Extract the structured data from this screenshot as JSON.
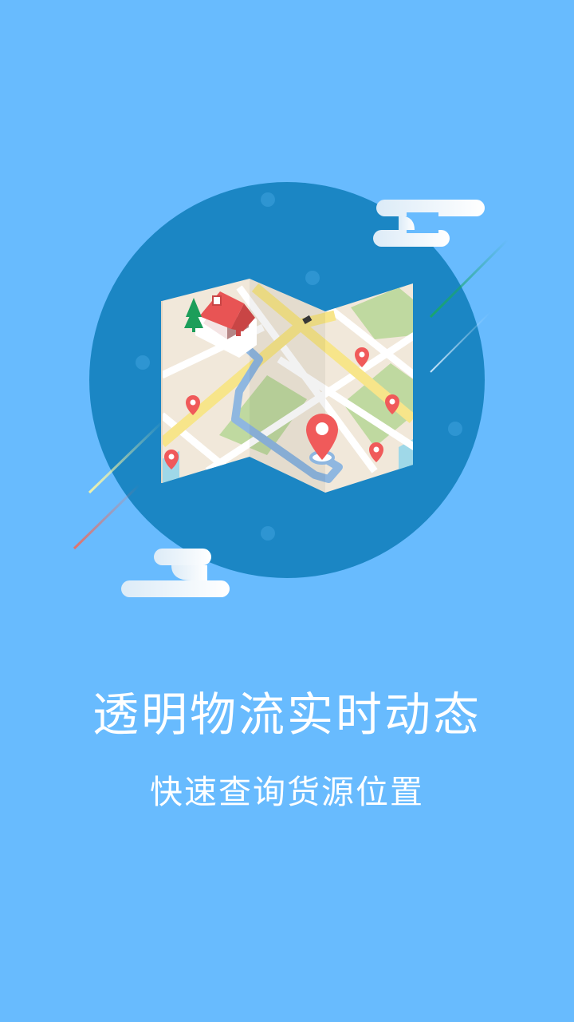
{
  "onboarding": {
    "title": "透明物流实时动态",
    "subtitle": "快速查询货源位置"
  },
  "colors": {
    "background": "#68BBFE",
    "circle": "#1B86C4",
    "map_land": "#F1E8DA",
    "map_road": "#F7E58A",
    "map_park": "#BFD9A0",
    "pin": "#F05A5A",
    "route": "#8FB7E0",
    "house_roof": "#E85454"
  },
  "icons": [
    "map-illustration",
    "house-icon",
    "map-pin-icon",
    "cloud-icon",
    "car-icon",
    "tree-icon"
  ]
}
